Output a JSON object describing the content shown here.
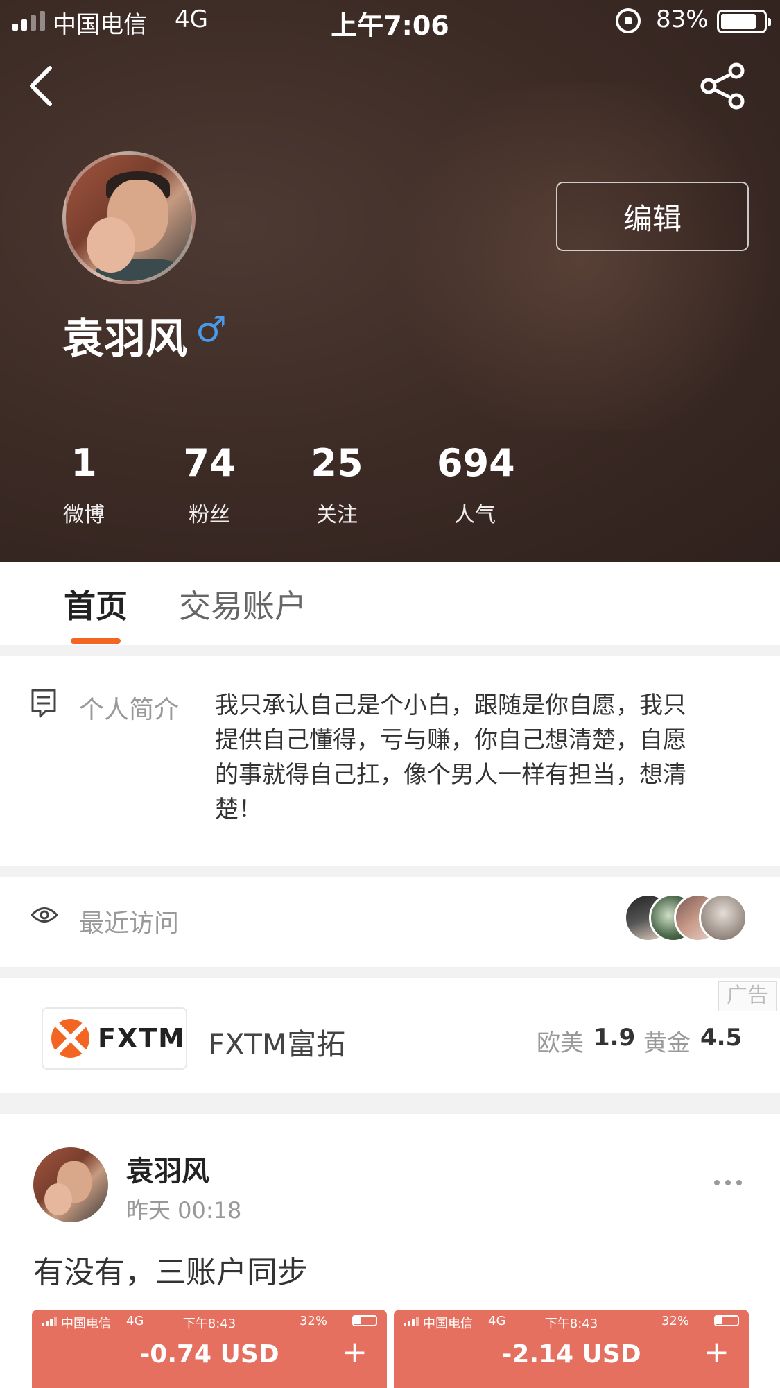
{
  "status_bar": {
    "carrier": "中国电信",
    "network": "4G",
    "time": "上午7:06",
    "battery_percent": "83%",
    "battery_level": 0.83
  },
  "profile": {
    "username": "袁羽风",
    "gender_symbol": "♂",
    "edit_label": "编辑",
    "stats": [
      {
        "value": "1",
        "label": "微博"
      },
      {
        "value": "74",
        "label": "粉丝"
      },
      {
        "value": "25",
        "label": "关注"
      },
      {
        "value": "694",
        "label": "人气"
      }
    ]
  },
  "tabs": [
    {
      "label": "首页",
      "active": true
    },
    {
      "label": "交易账户",
      "active": false
    }
  ],
  "bio": {
    "label": "个人简介",
    "text": "我只承认自己是个小白，跟随是你自愿，我只提供自己懂得，亏与赚，你自己想清楚，自愿的事就得自己扛，像个男人一样有担当，想清楚！"
  },
  "recent_visits": {
    "label": "最近访问"
  },
  "ad": {
    "tag": "广告",
    "logo_text": "FXTM",
    "name": "FXTM富拓",
    "quotes": [
      {
        "label": "欧美",
        "value": "1.9"
      },
      {
        "label": "黄金",
        "value": "4.5"
      }
    ]
  },
  "post": {
    "author": "袁羽风",
    "time": "昨天 00:18",
    "text": "有没有，三账户同步",
    "screenshots": [
      {
        "carrier": "中国电信",
        "network": "4G",
        "time": "下午8:43",
        "battery": "32%",
        "amount": "-0.74 USD",
        "plus": "+"
      },
      {
        "carrier": "中国电信",
        "network": "4G",
        "time": "下午8:43",
        "battery": "32%",
        "amount": "-2.14 USD",
        "plus": "+"
      }
    ]
  },
  "colors": {
    "accent": "#f26522",
    "gender": "#4a9ae8",
    "screenshot_bg": "#e6705f"
  }
}
